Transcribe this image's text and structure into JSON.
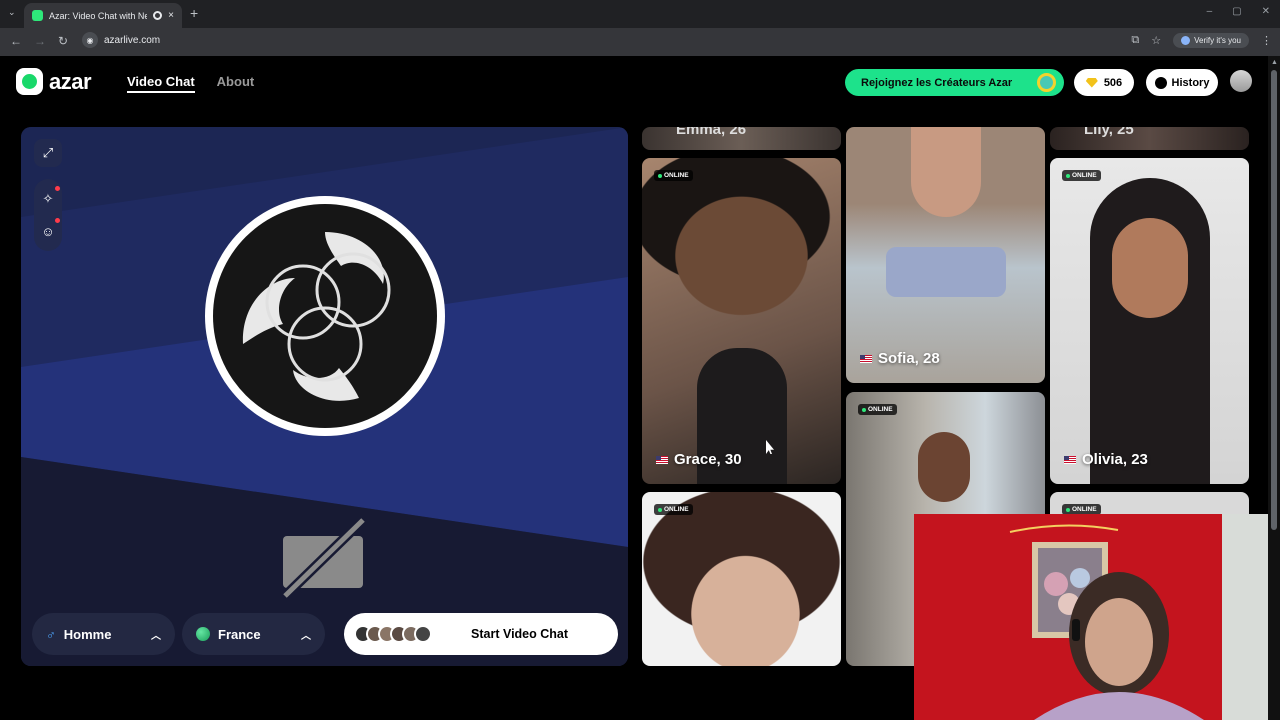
{
  "browser": {
    "tab_title": "Azar: Video Chat with New",
    "tab_close": "×",
    "new_tab": "+",
    "url": "azarlive.com",
    "verify_label": "Verify it's you",
    "back": "←",
    "forward": "→",
    "reload": "↻"
  },
  "header": {
    "logo_text": "azar",
    "nav": [
      {
        "label": "Video Chat",
        "active": true
      },
      {
        "label": "About",
        "active": false
      }
    ],
    "creators_label": "Rejoignez les Créateurs Azar",
    "gems_count": "506",
    "history_label": "History"
  },
  "video_panel": {
    "gender_label": "Homme",
    "country_label": "France",
    "start_label": "Start Video Chat",
    "colors": {
      "panel_bg": "#1a1f3d",
      "band": "#24327a"
    }
  },
  "profiles": [
    {
      "name": "Grace, 30",
      "status": "ONLINE",
      "flag": "us"
    },
    {
      "name": "Sofia, 28",
      "status": "",
      "flag": "us"
    },
    {
      "name": "Olivia, 23",
      "status": "ONLINE",
      "flag": "us"
    },
    {
      "name": "",
      "status": "ONLINE",
      "flag": ""
    },
    {
      "name": "",
      "status": "ONLINE",
      "flag": ""
    },
    {
      "name": "",
      "status": "ONLINE",
      "flag": ""
    }
  ],
  "colors": {
    "accent": "#1de28b",
    "gem": "#f2c21a",
    "online_dot": "#2ee87a"
  }
}
